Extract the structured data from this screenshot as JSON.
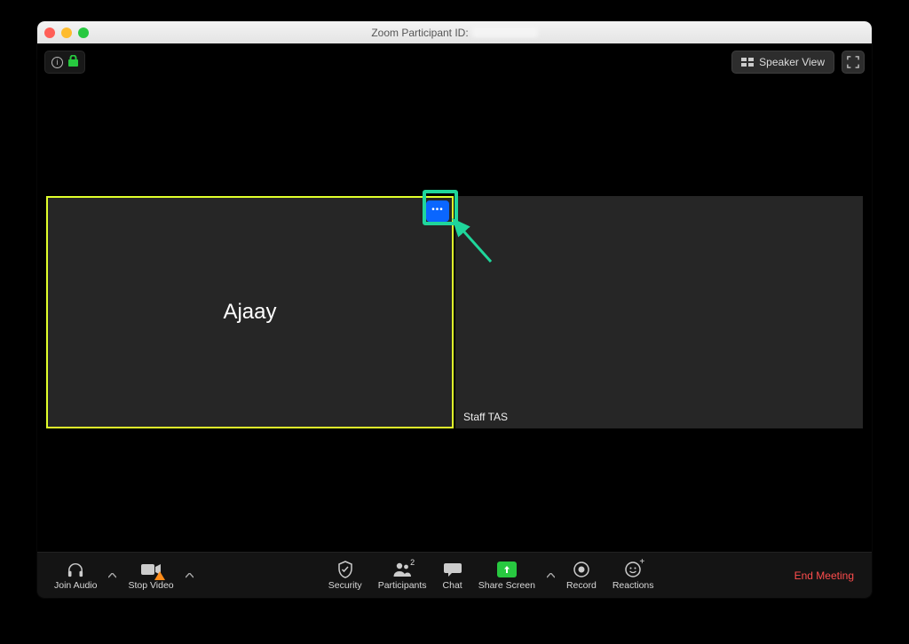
{
  "window": {
    "title_prefix": "Zoom Participant ID:"
  },
  "topbar": {
    "speaker_view_label": "Speaker View"
  },
  "tiles": {
    "main_name": "Ajaay",
    "second_name": "Staff TAS"
  },
  "toolbar": {
    "join_audio": "Join Audio",
    "stop_video": "Stop Video",
    "security": "Security",
    "participants": "Participants",
    "participants_count": "2",
    "chat": "Chat",
    "share_screen": "Share Screen",
    "record": "Record",
    "reactions": "Reactions",
    "end_meeting": "End Meeting"
  }
}
